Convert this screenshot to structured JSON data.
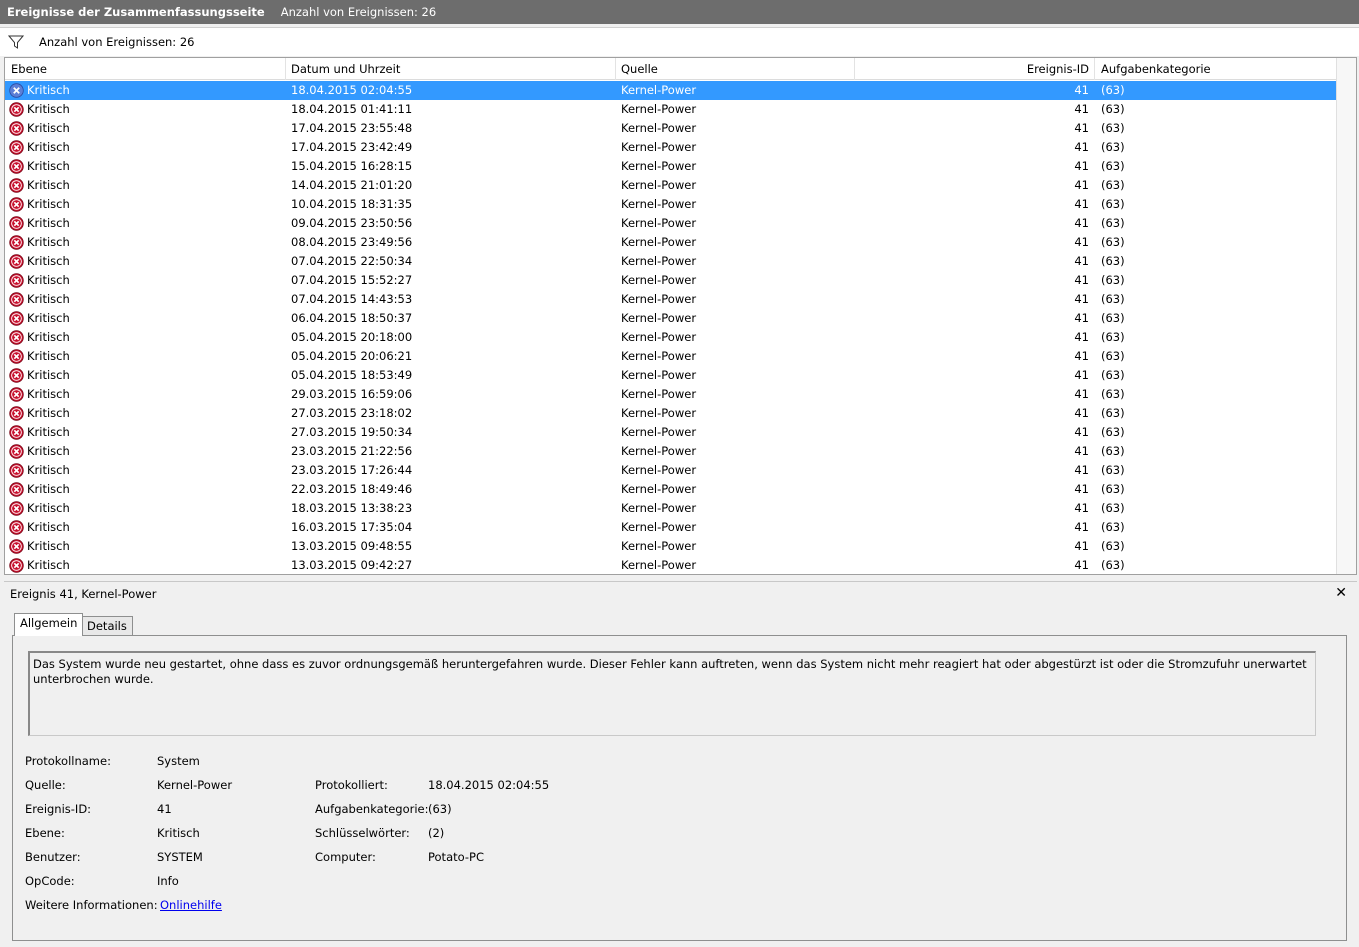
{
  "titlebar": {
    "title": "Ereignisse der Zusammenfassungsseite",
    "count_label": "Anzahl von Ereignissen: 26"
  },
  "filter": {
    "icon": "filter-icon",
    "count_label": "Anzahl von Ereignissen: 26"
  },
  "columns": [
    "Ebene",
    "Datum und Uhrzeit",
    "Quelle",
    "Ereignis-ID",
    "Aufgabenkategorie"
  ],
  "events": [
    {
      "level": "Kritisch",
      "date": "18.04.2015 02:04:55",
      "source": "Kernel-Power",
      "id": "41",
      "category": "(63)"
    },
    {
      "level": "Kritisch",
      "date": "18.04.2015 01:41:11",
      "source": "Kernel-Power",
      "id": "41",
      "category": "(63)"
    },
    {
      "level": "Kritisch",
      "date": "17.04.2015 23:55:48",
      "source": "Kernel-Power",
      "id": "41",
      "category": "(63)"
    },
    {
      "level": "Kritisch",
      "date": "17.04.2015 23:42:49",
      "source": "Kernel-Power",
      "id": "41",
      "category": "(63)"
    },
    {
      "level": "Kritisch",
      "date": "15.04.2015 16:28:15",
      "source": "Kernel-Power",
      "id": "41",
      "category": "(63)"
    },
    {
      "level": "Kritisch",
      "date": "14.04.2015 21:01:20",
      "source": "Kernel-Power",
      "id": "41",
      "category": "(63)"
    },
    {
      "level": "Kritisch",
      "date": "10.04.2015 18:31:35",
      "source": "Kernel-Power",
      "id": "41",
      "category": "(63)"
    },
    {
      "level": "Kritisch",
      "date": "09.04.2015 23:50:56",
      "source": "Kernel-Power",
      "id": "41",
      "category": "(63)"
    },
    {
      "level": "Kritisch",
      "date": "08.04.2015 23:49:56",
      "source": "Kernel-Power",
      "id": "41",
      "category": "(63)"
    },
    {
      "level": "Kritisch",
      "date": "07.04.2015 22:50:34",
      "source": "Kernel-Power",
      "id": "41",
      "category": "(63)"
    },
    {
      "level": "Kritisch",
      "date": "07.04.2015 15:52:27",
      "source": "Kernel-Power",
      "id": "41",
      "category": "(63)"
    },
    {
      "level": "Kritisch",
      "date": "07.04.2015 14:43:53",
      "source": "Kernel-Power",
      "id": "41",
      "category": "(63)"
    },
    {
      "level": "Kritisch",
      "date": "06.04.2015 18:50:37",
      "source": "Kernel-Power",
      "id": "41",
      "category": "(63)"
    },
    {
      "level": "Kritisch",
      "date": "05.04.2015 20:18:00",
      "source": "Kernel-Power",
      "id": "41",
      "category": "(63)"
    },
    {
      "level": "Kritisch",
      "date": "05.04.2015 20:06:21",
      "source": "Kernel-Power",
      "id": "41",
      "category": "(63)"
    },
    {
      "level": "Kritisch",
      "date": "05.04.2015 18:53:49",
      "source": "Kernel-Power",
      "id": "41",
      "category": "(63)"
    },
    {
      "level": "Kritisch",
      "date": "29.03.2015 16:59:06",
      "source": "Kernel-Power",
      "id": "41",
      "category": "(63)"
    },
    {
      "level": "Kritisch",
      "date": "27.03.2015 23:18:02",
      "source": "Kernel-Power",
      "id": "41",
      "category": "(63)"
    },
    {
      "level": "Kritisch",
      "date": "27.03.2015 19:50:34",
      "source": "Kernel-Power",
      "id": "41",
      "category": "(63)"
    },
    {
      "level": "Kritisch",
      "date": "23.03.2015 21:22:56",
      "source": "Kernel-Power",
      "id": "41",
      "category": "(63)"
    },
    {
      "level": "Kritisch",
      "date": "23.03.2015 17:26:44",
      "source": "Kernel-Power",
      "id": "41",
      "category": "(63)"
    },
    {
      "level": "Kritisch",
      "date": "22.03.2015 18:49:46",
      "source": "Kernel-Power",
      "id": "41",
      "category": "(63)"
    },
    {
      "level": "Kritisch",
      "date": "18.03.2015 13:38:23",
      "source": "Kernel-Power",
      "id": "41",
      "category": "(63)"
    },
    {
      "level": "Kritisch",
      "date": "16.03.2015 17:35:04",
      "source": "Kernel-Power",
      "id": "41",
      "category": "(63)"
    },
    {
      "level": "Kritisch",
      "date": "13.03.2015 09:48:55",
      "source": "Kernel-Power",
      "id": "41",
      "category": "(63)"
    },
    {
      "level": "Kritisch",
      "date": "13.03.2015 09:42:27",
      "source": "Kernel-Power",
      "id": "41",
      "category": "(63)"
    }
  ],
  "selected_index": 0,
  "colors": {
    "selection": "#3399ff",
    "critical": "#c8102e",
    "link": "#0000ee"
  },
  "detail": {
    "title": "Ereignis 41, Kernel-Power",
    "close_icon": "close-icon",
    "tabs": [
      "Allgemein",
      "Details"
    ],
    "description": "Das System wurde neu gestartet, ohne dass es zuvor ordnungsgemäß heruntergefahren wurde. Dieser Fehler kann auftreten, wenn das System nicht mehr reagiert hat oder abgestürzt ist oder die Stromzufuhr unerwartet unterbrochen wurde.",
    "fields": {
      "protokollname_label": "Protokollname:",
      "protokollname": "System",
      "quelle_label": "Quelle:",
      "quelle": "Kernel-Power",
      "protokolliert_label": "Protokolliert:",
      "protokolliert": "18.04.2015 02:04:55",
      "ereignis_id_label": "Ereignis-ID:",
      "ereignis_id": "41",
      "aufgabenkategorie_label": "Aufgabenkategorie:",
      "aufgabenkategorie": "(63)",
      "ebene_label": "Ebene:",
      "ebene": "Kritisch",
      "schluesselwoerter_label": "Schlüsselwörter:",
      "schluesselwoerter": "(2)",
      "benutzer_label": "Benutzer:",
      "benutzer": "SYSTEM",
      "computer_label": "Computer:",
      "computer": "Potato-PC",
      "opcode_label": "OpCode:",
      "opcode": "Info",
      "weitere_label": "Weitere Informationen:",
      "weitere_link": "Onlinehilfe"
    }
  }
}
